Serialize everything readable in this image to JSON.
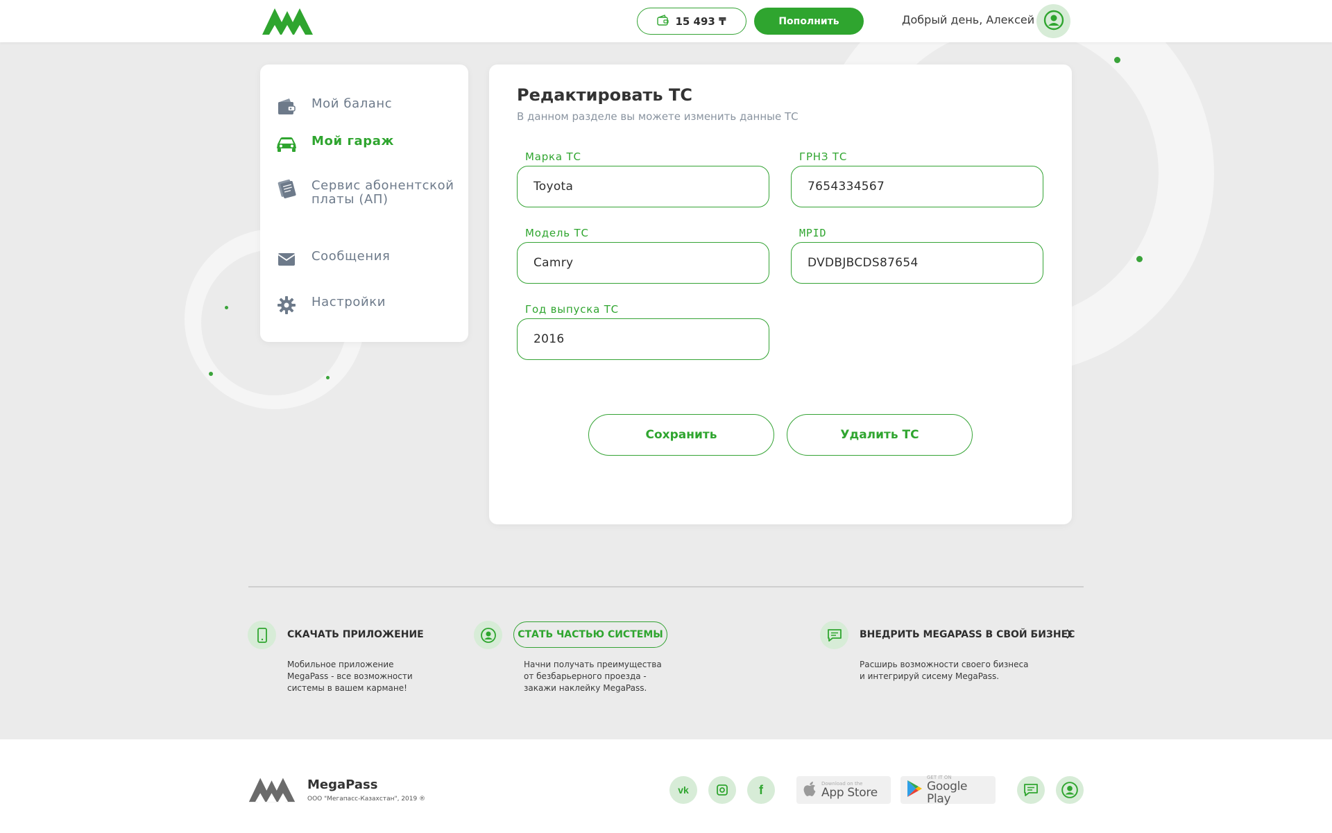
{
  "header": {
    "balance": "15 493 ₸",
    "topup_label": "Пополнить",
    "greeting": "Добрый день, Алексей"
  },
  "sidebar": {
    "items": [
      {
        "label": "Мой баланс",
        "icon": "wallet-icon"
      },
      {
        "label": "Мой гараж",
        "icon": "car-icon",
        "active": true
      },
      {
        "label": "Сервис абонентской платы (АП)",
        "icon": "tickets-icon"
      },
      {
        "label": "Сообщения",
        "icon": "envelope-icon"
      },
      {
        "label": "Настройки",
        "icon": "gear-icon"
      }
    ]
  },
  "card": {
    "title": "Редактировать ТС",
    "subtitle": "В данном разделе вы можете изменить данные ТС",
    "fields": {
      "brand": {
        "label": "Марка ТС",
        "value": "Toyota"
      },
      "plate": {
        "label": "ГРНЗ ТС",
        "value": "7654334567"
      },
      "model": {
        "label": "Модель ТС",
        "value": "Camry"
      },
      "mpid": {
        "label": "MPID",
        "value": "DVDBJBCDS87654"
      },
      "year": {
        "label": "Год выпуска ТС",
        "value": "2016"
      }
    },
    "save_label": "Сохранить",
    "delete_label": "Удалить ТС"
  },
  "features": {
    "download": {
      "title": "СКАЧАТЬ ПРИЛОЖЕНИЕ",
      "desc_lines": [
        "Мобильное приложение",
        "MegaPass - все возможности",
        "системы в вашем кармане!"
      ]
    },
    "join": {
      "title": "СТАТЬ ЧАСТЬЮ СИСТЕМЫ",
      "desc_lines": [
        "Начни получать преимущества",
        "от безбарьерного проезда -",
        "закажи наклейку MegaPass."
      ]
    },
    "business": {
      "title": "ВНЕДРИТЬ MEGAPASS В СВОЙ БИЗНЕС",
      "desc_lines": [
        "Расширь возможности своего бизнеса",
        "и интегрируй сисему MegaPass."
      ]
    }
  },
  "footer": {
    "brand_name": "MegaPass",
    "copyright": "ООО \"Мегапасс-Казахстан\", 2019 ®",
    "appstore_small": "Download on the",
    "appstore_big": "App Store",
    "googleplay_small": "GET IT ON",
    "googleplay_big": "Google Play"
  },
  "colors": {
    "accent": "#2fa52f",
    "accent_light": "#d7ecd7",
    "background": "#ebebeb"
  }
}
